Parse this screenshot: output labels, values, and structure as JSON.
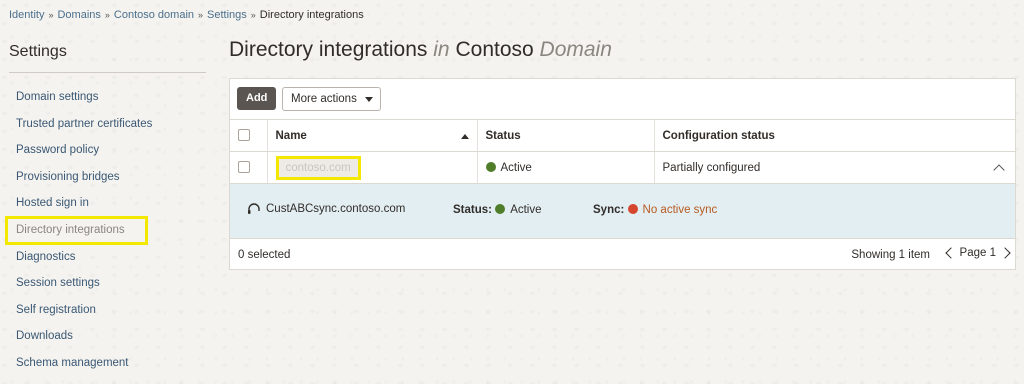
{
  "breadcrumb": {
    "items": [
      "Identity",
      "Domains",
      "Contoso domain",
      "Settings"
    ],
    "current": "Directory integrations"
  },
  "sidebar": {
    "title": "Settings",
    "items": [
      {
        "label": "Domain settings"
      },
      {
        "label": "Trusted partner certificates"
      },
      {
        "label": "Password policy"
      },
      {
        "label": "Provisioning bridges"
      },
      {
        "label": "Hosted sign in"
      },
      {
        "label": "Directory integrations",
        "active": true
      },
      {
        "label": "Diagnostics"
      },
      {
        "label": "Session settings"
      },
      {
        "label": "Self registration"
      },
      {
        "label": "Downloads"
      },
      {
        "label": "Schema management"
      }
    ]
  },
  "page": {
    "title_main": "Directory integrations",
    "title_in": "in",
    "title_org": "Contoso",
    "title_domain": "Domain"
  },
  "toolbar": {
    "add_label": "Add",
    "more_actions_label": "More actions"
  },
  "table": {
    "columns": [
      "Name",
      "Status",
      "Configuration status"
    ],
    "rows": [
      {
        "name": "contoso.com",
        "status": "Active",
        "config_status": "Partially configured"
      }
    ]
  },
  "detail": {
    "host": "CustABCsync.contoso.com",
    "status_label": "Status:",
    "status_value": "Active",
    "sync_label": "Sync:",
    "sync_value": "No active sync"
  },
  "footer": {
    "selected_text": "0 selected",
    "showing_text": "Showing 1 item",
    "page_label": "Page 1"
  },
  "colors": {
    "accent_green": "#4f7d2a",
    "accent_red": "#d6452e",
    "highlight_yellow": "#f5e800",
    "link_blue": "#3a5874"
  },
  "icons": [
    "sort-ascending-icon",
    "chevron-up-icon",
    "headset-icon",
    "chevron-left-icon",
    "chevron-right-icon",
    "caret-down-icon"
  ]
}
